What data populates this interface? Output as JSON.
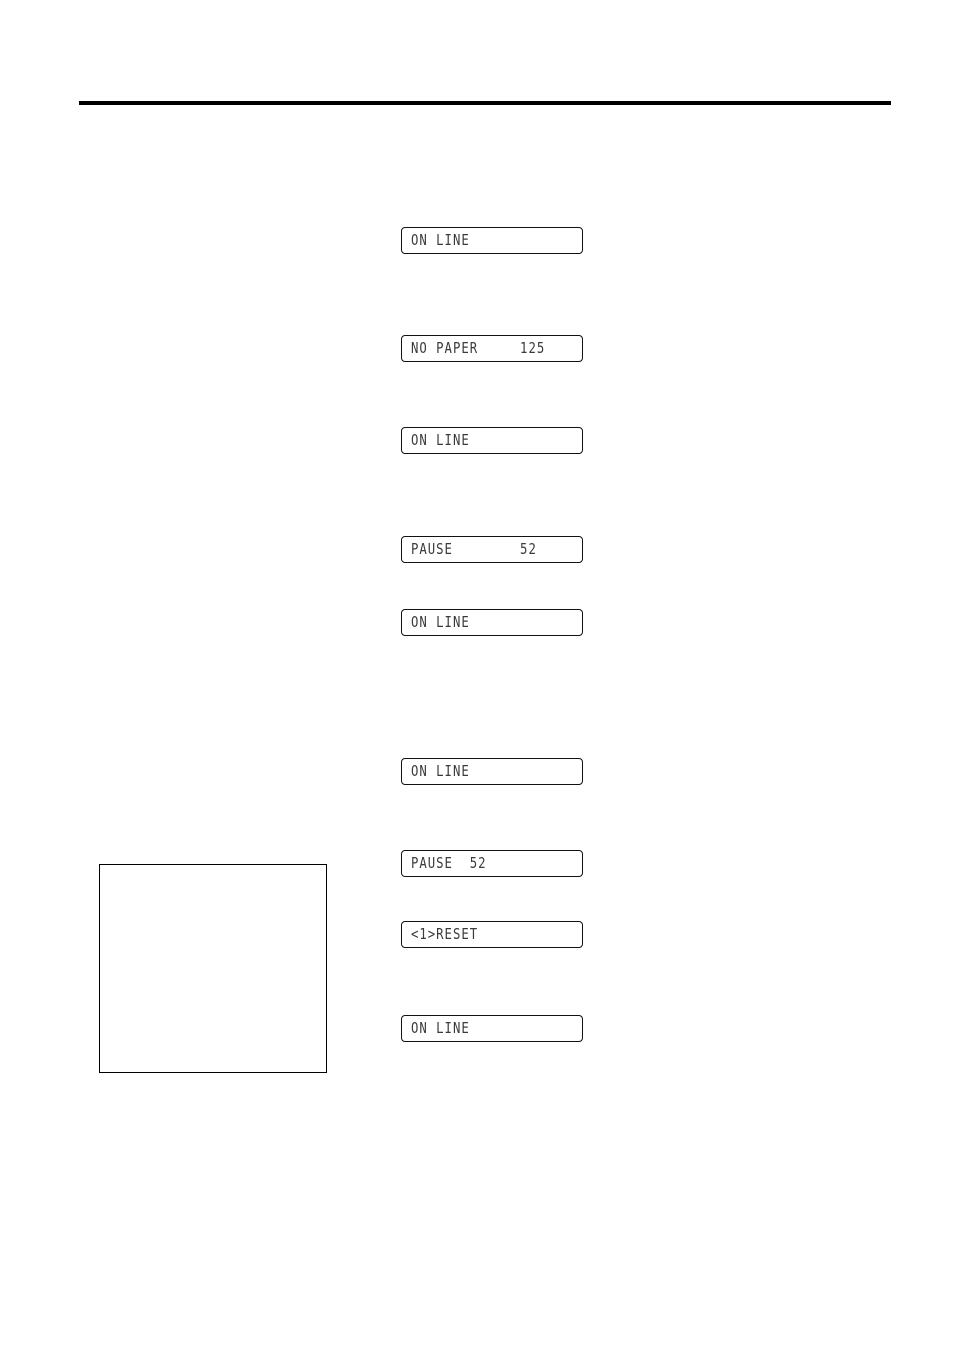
{
  "page": {
    "lcd_displays": [
      {
        "text": "ON LINE"
      },
      {
        "text": "NO PAPER     125"
      },
      {
        "text": "ON LINE"
      },
      {
        "text": "PAUSE        52"
      },
      {
        "text": "ON LINE"
      },
      {
        "text": "ON LINE"
      },
      {
        "text": "PAUSE  52"
      },
      {
        "text": "<1>RESET"
      },
      {
        "text": "ON LINE"
      }
    ],
    "note_box": {
      "text": ""
    }
  }
}
